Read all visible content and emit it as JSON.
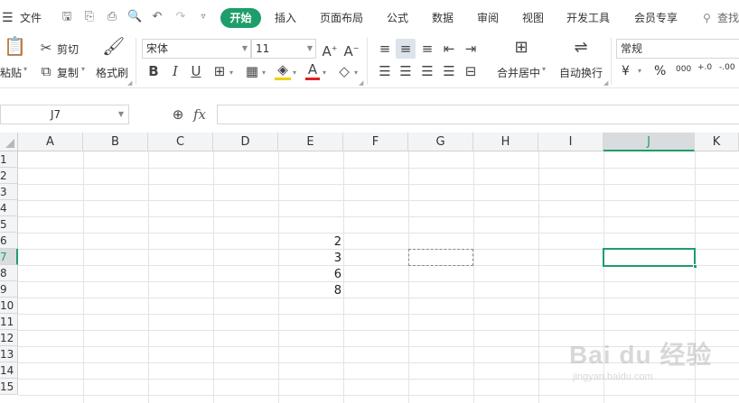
{
  "menubar": {
    "hamburger_icon": "menu-icon",
    "file_label": "文件",
    "tabs": [
      "开始",
      "插入",
      "页面布局",
      "公式",
      "数据",
      "审阅",
      "视图",
      "开发工具",
      "会员专享"
    ],
    "search_label": "查找",
    "accent_color": "#1e9e6a"
  },
  "ribbon": {
    "paste_label": "粘贴",
    "cut_label": "剪切",
    "copy_label": "复制",
    "format_painter_label": "格式刷",
    "font_name": "宋体",
    "font_size": "11",
    "merge_label": "合并居中",
    "wrap_label": "自动换行",
    "number_format": "常规",
    "percent_symbol": "%",
    "currency_symbol": "¥",
    "thousands_symbol": "000",
    "inc_decimal": "+.0",
    "dec_decimal": "-.00"
  },
  "formula_bar": {
    "name_box": "J7",
    "fx_label": "fx",
    "formula": ""
  },
  "sheet": {
    "columns": [
      "A",
      "B",
      "C",
      "D",
      "E",
      "F",
      "G",
      "H",
      "I",
      "J",
      "K"
    ],
    "rows": [
      "1",
      "2",
      "3",
      "4",
      "5",
      "6",
      "7",
      "8",
      "9",
      "10",
      "11",
      "12",
      "13",
      "14",
      "15"
    ],
    "active_cell": "J7",
    "cells": {
      "E6": "2",
      "E7": "3",
      "E8": "6",
      "E9": "8"
    },
    "copy_marquee_cell": "G7"
  },
  "watermark": {
    "text": "Bai du 经验",
    "url": "jingyan.baidu.com"
  }
}
